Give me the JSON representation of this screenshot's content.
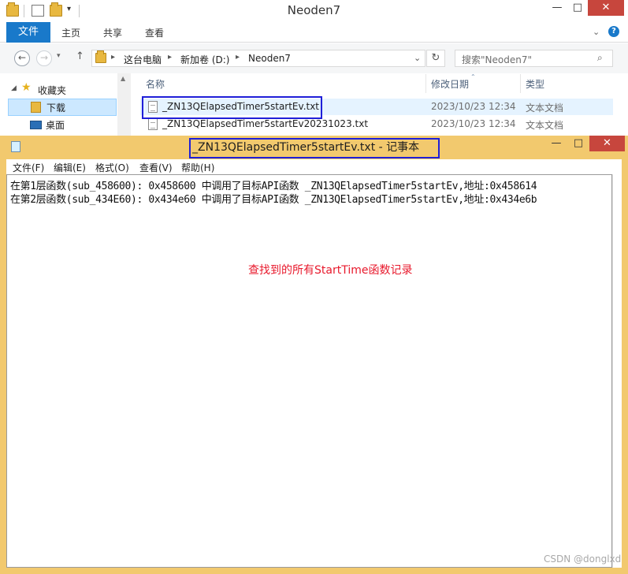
{
  "explorer": {
    "title": "Neoden7",
    "ribbon": {
      "file": "文件",
      "tabs": [
        "主页",
        "共享",
        "查看"
      ]
    },
    "address": {
      "crumbs": [
        "这台电脑",
        "新加卷 (D:)",
        "Neoden7"
      ]
    },
    "search": {
      "placeholder": "搜索\"Neoden7\""
    },
    "nav": {
      "favorites": "收藏夹",
      "items": [
        "下载",
        "桌面"
      ]
    },
    "columns": {
      "name": "名称",
      "date": "修改日期",
      "type": "类型"
    },
    "files": [
      {
        "name": "_ZN13QElapsedTimer5startEv.txt",
        "date": "2023/10/23 12:34",
        "type": "文本文档"
      },
      {
        "name": "_ZN13QElapsedTimer5startEv20231023.txt",
        "date": "2023/10/23 12:34",
        "type": "文本文档"
      }
    ]
  },
  "notepad": {
    "title": "_ZN13QElapsedTimer5startEv.txt - 记事本",
    "menu": [
      "文件(F)",
      "编辑(E)",
      "格式(O)",
      "查看(V)",
      "帮助(H)"
    ],
    "lines": [
      "在第1层函数(sub_458600): 0x458600 中调用了目标API函数 _ZN13QElapsedTimer5startEv,地址:0x458614",
      "在第2层函数(sub_434E60): 0x434e60 中调用了目标API函数 _ZN13QElapsedTimer5startEv,地址:0x434e6b"
    ],
    "annotation": "查找到的所有StartTime函数记录"
  },
  "watermark": "CSDN @donglxd",
  "colors": {
    "annotation_red": "#e8192c",
    "highlight_blue": "#1f1fd8",
    "notepad_frame": "#f2c96e",
    "file_tab": "#1979ca"
  }
}
